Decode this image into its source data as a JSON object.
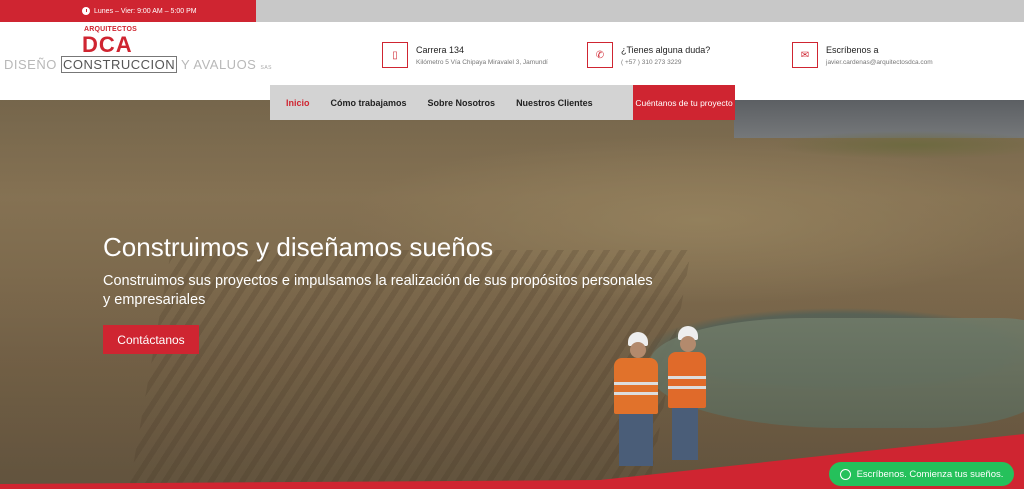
{
  "topbar": {
    "hours": "Lunes – Vier: 9:00 AM – 5:00 PM",
    "accent": "#cf2531"
  },
  "logo": {
    "top": "ARQUITECTOS",
    "main": "DCA",
    "sub1": "DISEÑO",
    "sub2": "CONSTRUCCION",
    "sub3": "Y AVALUOS",
    "sub4": "SAS"
  },
  "contacts": [
    {
      "icon": "building-icon",
      "title": "Carrera 134",
      "detail": "Kilómetro 5 Vía Chipaya Miravalel 3, Jamundí"
    },
    {
      "icon": "phone-icon",
      "title": "¿Tienes alguna duda?",
      "detail": "( +57 ) 310 273 3229"
    },
    {
      "icon": "mail-icon",
      "title": "Escríbenos a",
      "detail": "javier.cardenas@arquitectosdca.com"
    }
  ],
  "nav": {
    "items": [
      "Inicio",
      "Cómo trabajamos",
      "Sobre Nosotros",
      "Nuestros Clientes"
    ],
    "active": "Inicio",
    "cta": "Cuéntanos de tu proyecto"
  },
  "hero": {
    "title": "Construimos y diseñamos sueños",
    "subtitle": "Construimos sus proyectos e impulsamos la realización de sus propósitos personales y empresariales",
    "button": "Contáctanos"
  },
  "whatsapp": {
    "label": "Escríbenos. Comienza tus sueños.",
    "color": "#25c15b"
  }
}
